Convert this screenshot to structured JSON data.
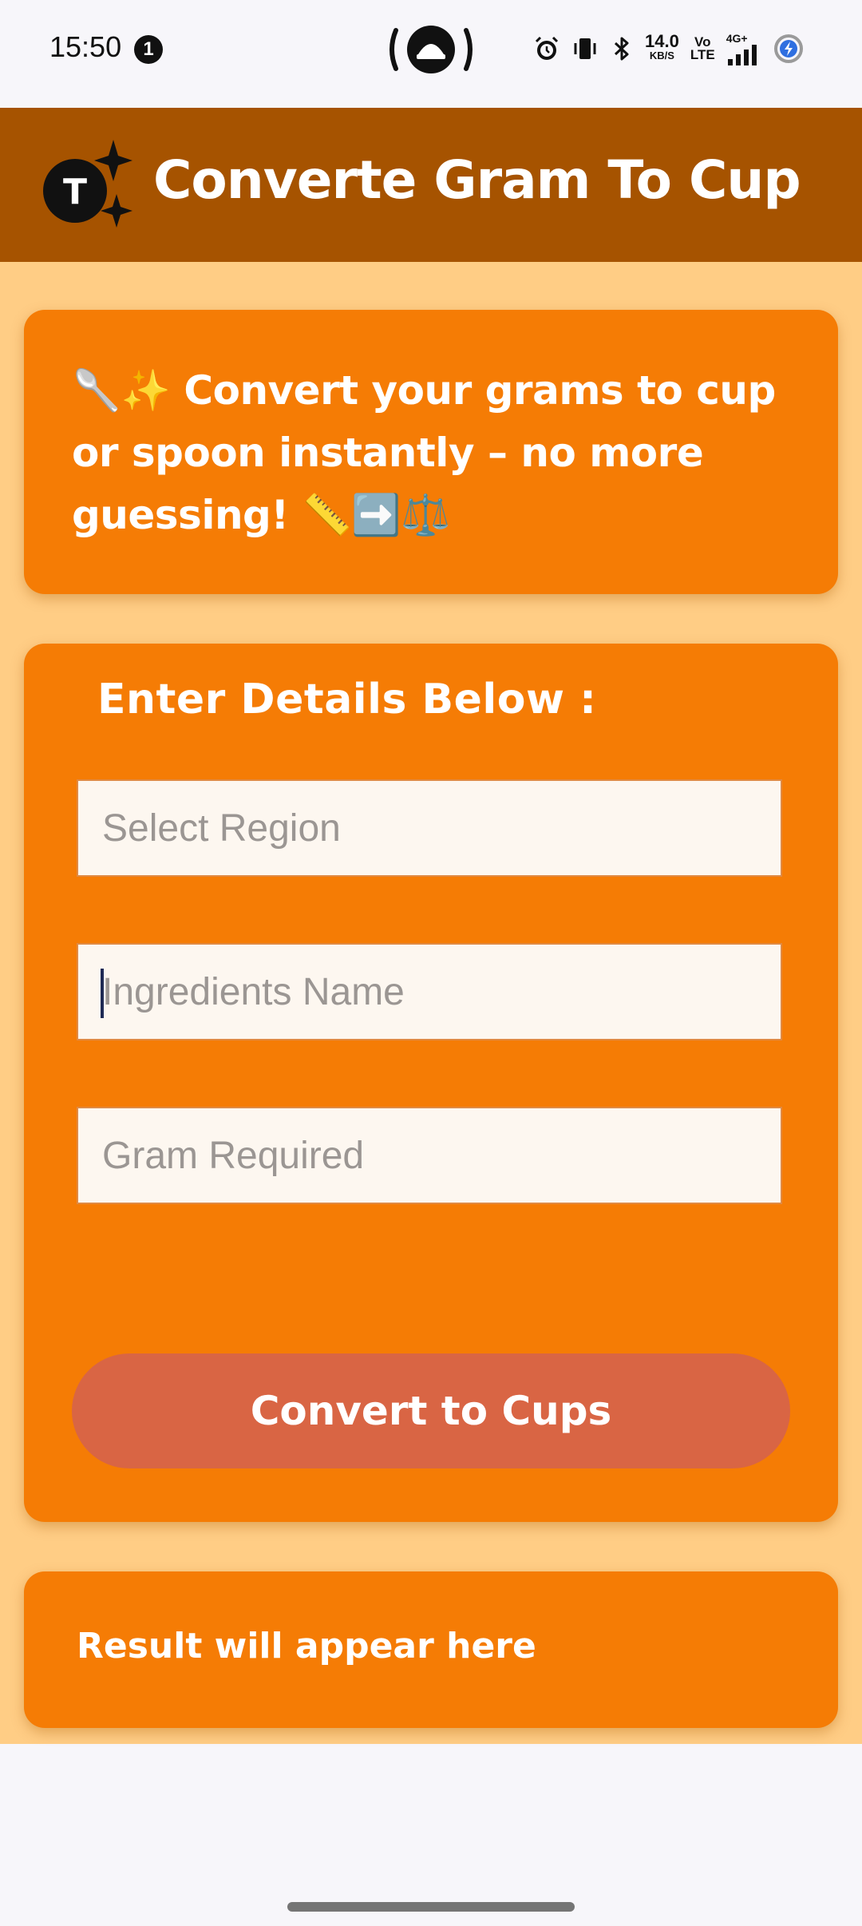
{
  "status_bar": {
    "time": "15:50",
    "notification_count": "1",
    "speed_value": "14.0",
    "speed_unit": "KB/S",
    "volte_line1": "Vo",
    "volte_line2": "LTE",
    "network": "4G+",
    "icons": [
      "cast-icon",
      "alarm-icon",
      "vibrate-icon",
      "bluetooth-icon",
      "signal-icon",
      "battery-saver-icon"
    ]
  },
  "app_bar": {
    "logo_letter": "T",
    "title": "Converte Gram To Cup"
  },
  "intro": {
    "text": "🥄✨ Convert your grams to cup or spoon instantly – no more guessing! 📏➡️⚖️"
  },
  "form": {
    "title": "Enter Details Below :",
    "region_placeholder": "Select Region",
    "ingredient_placeholder": "Ingredients Name",
    "gram_placeholder": "Gram Required",
    "button_label": "Convert to Cups"
  },
  "result": {
    "text": "Result will appear here"
  },
  "colors": {
    "app_bar": "#a65300",
    "background": "#ffcd85",
    "card": "#f57c05",
    "button": "#d96544"
  }
}
